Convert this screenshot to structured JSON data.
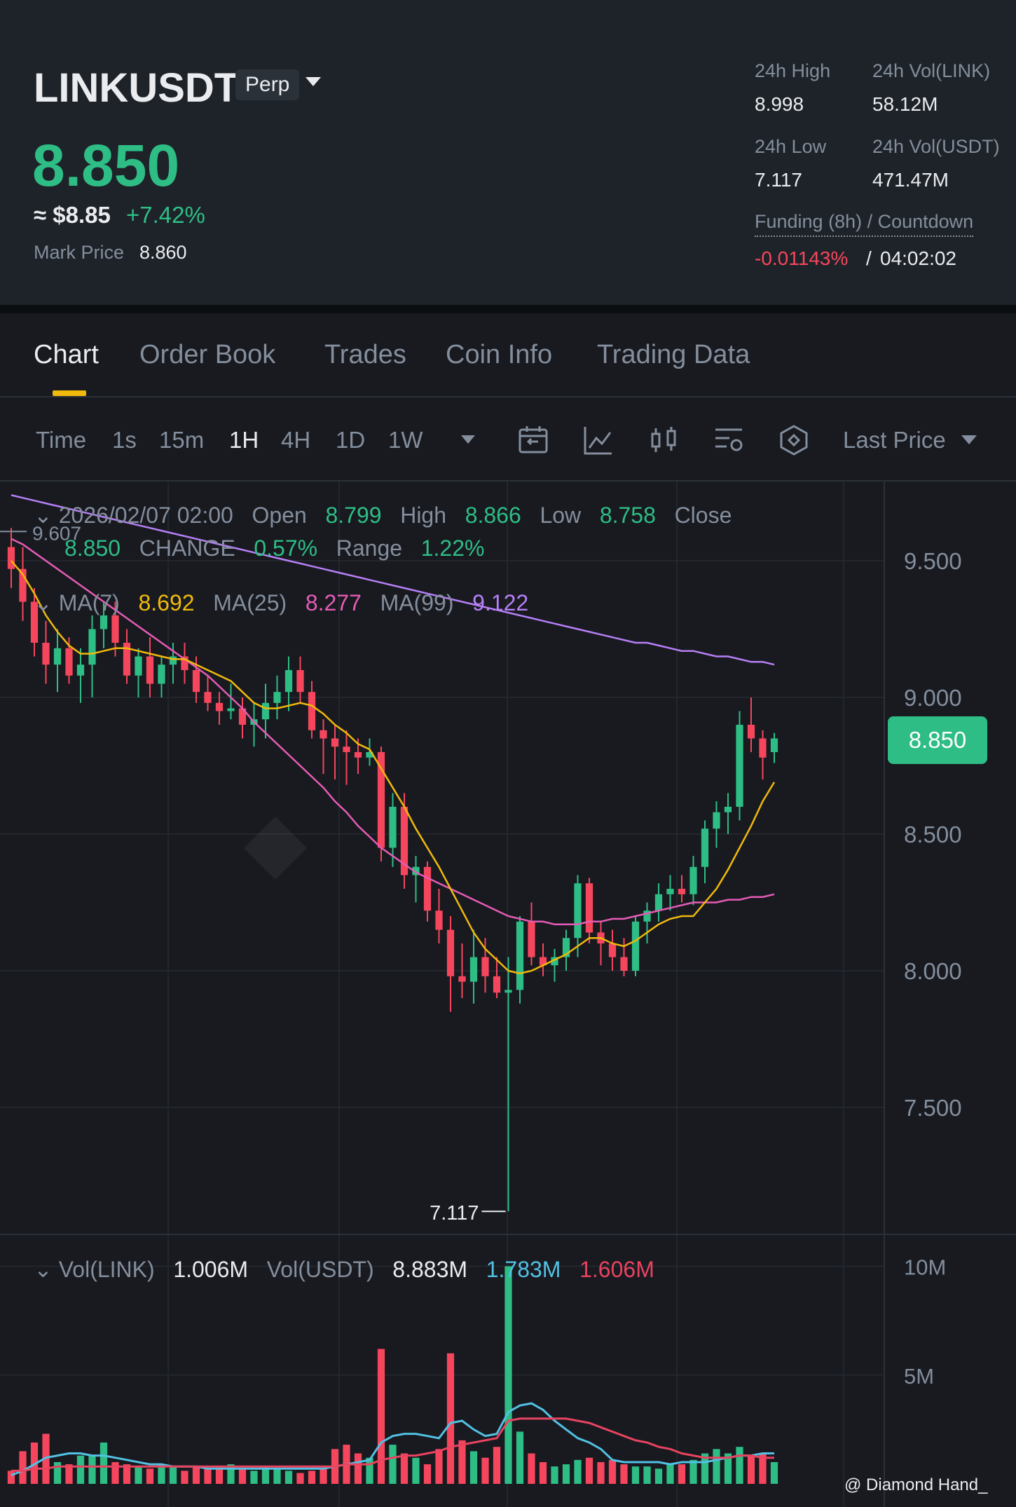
{
  "header": {
    "symbol": "LINKUSDT",
    "contract_type": "Perp",
    "last_price": "8.850",
    "usd_price": "≈ $8.85",
    "change_pct": "+7.42%",
    "mark_price_label": "Mark Price",
    "mark_price": "8.860",
    "stats": {
      "high_label": "24h High",
      "high": "8.998",
      "low_label": "24h Low",
      "low": "7.117",
      "vol_link_label": "24h Vol(LINK)",
      "vol_link": "58.12M",
      "vol_usdt_label": "24h Vol(USDT)",
      "vol_usdt": "471.47M"
    },
    "funding_label": "Funding (8h) / Countdown",
    "funding_rate": "-0.01143%",
    "funding_sep": "/",
    "countdown": "04:02:02"
  },
  "tabs": [
    {
      "label": "Chart",
      "active": true
    },
    {
      "label": "Order Book"
    },
    {
      "label": "Trades"
    },
    {
      "label": "Coin Info"
    },
    {
      "label": "Trading Data"
    }
  ],
  "toolbar": {
    "timeframes": [
      "Time",
      "1s",
      "15m",
      "1H",
      "4H",
      "1D",
      "1W"
    ],
    "active_timeframe": "1H",
    "icons": [
      "calendar-icon",
      "indicator-icon",
      "candle-type-icon",
      "settings-icon",
      "depth-icon"
    ],
    "price_source": "Last Price"
  },
  "chart_info": {
    "date": "2026/02/07 02:00",
    "open_label": "Open",
    "open": "8.799",
    "high_label": "High",
    "high": "8.866",
    "low_label": "Low",
    "low": "8.758",
    "close_label": "Close",
    "close": "8.850",
    "change_label": "CHANGE",
    "change": "0.57%",
    "range_label": "Range",
    "range": "1.22%",
    "ma7_label": "MA(7)",
    "ma7": "8.692",
    "ma25_label": "MA(25)",
    "ma25": "8.277",
    "ma99_label": "MA(99)",
    "ma99": "9.122",
    "left_max_label": "9.607",
    "min_label": "7.117",
    "current_price_tag": "8.850",
    "vol_link_label": "Vol(LINK)",
    "vol_link": "1.006M",
    "vol_usdt_label": "Vol(USDT)",
    "vol_usdt": "8.883M",
    "vol_ma1": "1.783M",
    "vol_ma2": "1.606M",
    "watermark": "@ Diamond Hand_"
  },
  "colors": {
    "up": "#2ebd85",
    "down": "#f6465d",
    "ma7": "#f0b90b",
    "ma25": "#e55bb5",
    "ma99": "#b67ff6",
    "vol_ma1": "#52c1e3",
    "vol_ma2": "#e8435f",
    "accent": "#f0b90b"
  },
  "chart_data": {
    "type": "candlestick",
    "interval": "1H",
    "y_ticks": [
      "9.500",
      "9.000",
      "8.500",
      "8.000",
      "7.500"
    ],
    "y_range": [
      7.0,
      9.75
    ],
    "vol_ticks": [
      "10M",
      "5M"
    ],
    "vol_range": [
      0,
      10.5
    ],
    "candles": [
      [
        9.55,
        9.62,
        9.4,
        9.47
      ],
      [
        9.47,
        9.55,
        9.28,
        9.35
      ],
      [
        9.35,
        9.4,
        9.15,
        9.2
      ],
      [
        9.2,
        9.28,
        9.05,
        9.12
      ],
      [
        9.12,
        9.25,
        9.02,
        9.18
      ],
      [
        9.18,
        9.22,
        9.05,
        9.08
      ],
      [
        9.08,
        9.18,
        8.98,
        9.12
      ],
      [
        9.12,
        9.3,
        9.0,
        9.25
      ],
      [
        9.25,
        9.35,
        9.18,
        9.3
      ],
      [
        9.3,
        9.35,
        9.15,
        9.2
      ],
      [
        9.2,
        9.25,
        9.05,
        9.08
      ],
      [
        9.08,
        9.18,
        9.0,
        9.15
      ],
      [
        9.15,
        9.22,
        9.0,
        9.05
      ],
      [
        9.05,
        9.15,
        9.0,
        9.12
      ],
      [
        9.12,
        9.2,
        9.05,
        9.15
      ],
      [
        9.15,
        9.2,
        9.05,
        9.1
      ],
      [
        9.1,
        9.15,
        8.98,
        9.02
      ],
      [
        9.02,
        9.08,
        8.95,
        8.98
      ],
      [
        8.98,
        9.02,
        8.9,
        8.95
      ],
      [
        8.95,
        9.05,
        8.92,
        8.96
      ],
      [
        8.96,
        9.0,
        8.85,
        8.9
      ],
      [
        8.9,
        8.98,
        8.82,
        8.92
      ],
      [
        8.92,
        9.05,
        8.85,
        8.98
      ],
      [
        8.98,
        9.08,
        8.92,
        9.02
      ],
      [
        9.02,
        9.15,
        8.95,
        9.1
      ],
      [
        9.1,
        9.15,
        8.98,
        9.02
      ],
      [
        9.02,
        9.06,
        8.85,
        8.88
      ],
      [
        8.88,
        8.92,
        8.72,
        8.85
      ],
      [
        8.85,
        8.9,
        8.7,
        8.82
      ],
      [
        8.82,
        8.88,
        8.68,
        8.8
      ],
      [
        8.8,
        8.85,
        8.72,
        8.78
      ],
      [
        8.78,
        8.85,
        8.75,
        8.8
      ],
      [
        8.8,
        8.82,
        8.4,
        8.45
      ],
      [
        8.45,
        8.65,
        8.38,
        8.6
      ],
      [
        8.6,
        8.65,
        8.3,
        8.35
      ],
      [
        8.35,
        8.42,
        8.25,
        8.38
      ],
      [
        8.38,
        8.4,
        8.18,
        8.22
      ],
      [
        8.22,
        8.3,
        8.1,
        8.15
      ],
      [
        8.15,
        8.2,
        7.85,
        7.98
      ],
      [
        7.98,
        8.1,
        7.9,
        7.96
      ],
      [
        7.96,
        8.15,
        7.88,
        8.05
      ],
      [
        8.05,
        8.12,
        7.92,
        7.98
      ],
      [
        7.98,
        8.05,
        7.9,
        7.92
      ],
      [
        7.92,
        8.05,
        7.12,
        7.93
      ],
      [
        7.93,
        8.2,
        7.88,
        8.18
      ],
      [
        8.18,
        8.25,
        8.02,
        8.05
      ],
      [
        8.05,
        8.1,
        7.98,
        8.02
      ],
      [
        8.02,
        8.08,
        7.96,
        8.05
      ],
      [
        8.05,
        8.15,
        8.0,
        8.12
      ],
      [
        8.12,
        8.35,
        8.05,
        8.32
      ],
      [
        8.32,
        8.34,
        8.1,
        8.14
      ],
      [
        8.14,
        8.18,
        8.02,
        8.1
      ],
      [
        8.1,
        8.15,
        8.0,
        8.05
      ],
      [
        8.05,
        8.12,
        7.98,
        8.0
      ],
      [
        8.0,
        8.2,
        7.98,
        8.18
      ],
      [
        8.18,
        8.25,
        8.1,
        8.22
      ],
      [
        8.22,
        8.32,
        8.18,
        8.28
      ],
      [
        8.28,
        8.35,
        8.22,
        8.3
      ],
      [
        8.3,
        8.35,
        8.25,
        8.28
      ],
      [
        8.28,
        8.42,
        8.24,
        8.38
      ],
      [
        8.38,
        8.55,
        8.32,
        8.52
      ],
      [
        8.52,
        8.62,
        8.45,
        8.58
      ],
      [
        8.58,
        8.65,
        8.5,
        8.6
      ],
      [
        8.6,
        8.95,
        8.55,
        8.9
      ],
      [
        8.9,
        9.0,
        8.8,
        8.85
      ],
      [
        8.85,
        8.88,
        8.7,
        8.78
      ],
      [
        8.8,
        8.87,
        8.76,
        8.85
      ]
    ],
    "volumes": [
      0.6,
      1.5,
      1.9,
      2.3,
      1.0,
      0.9,
      1.3,
      1.3,
      1.9,
      1.0,
      0.9,
      0.8,
      0.7,
      0.9,
      0.8,
      0.6,
      0.8,
      0.7,
      0.8,
      0.9,
      0.7,
      0.6,
      0.8,
      0.7,
      0.6,
      0.5,
      0.6,
      0.7,
      1.6,
      1.8,
      1.4,
      1.2,
      6.2,
      1.8,
      1.4,
      1.2,
      0.9,
      1.6,
      6.0,
      2.0,
      1.5,
      1.2,
      1.7,
      10.0,
      2.4,
      1.4,
      1.0,
      0.8,
      0.9,
      1.1,
      1.2,
      1.0,
      1.1,
      0.9,
      0.8,
      0.8,
      0.7,
      0.9,
      0.9,
      1.1,
      1.4,
      1.6,
      1.4,
      1.7,
      1.3,
      1.4,
      1.0
    ],
    "ma7": [
      9.5,
      9.45,
      9.38,
      9.3,
      9.24,
      9.19,
      9.16,
      9.16,
      9.17,
      9.18,
      9.18,
      9.17,
      9.16,
      9.15,
      9.14,
      9.14,
      9.12,
      9.1,
      9.08,
      9.06,
      9.02,
      8.98,
      8.96,
      8.96,
      8.97,
      8.98,
      8.97,
      8.94,
      8.9,
      8.87,
      8.83,
      8.81,
      8.74,
      8.67,
      8.6,
      8.52,
      8.45,
      8.38,
      8.3,
      8.22,
      8.14,
      8.08,
      8.04,
      8.0,
      7.99,
      8.0,
      8.02,
      8.04,
      8.06,
      8.09,
      8.12,
      8.12,
      8.1,
      8.09,
      8.11,
      8.14,
      8.17,
      8.19,
      8.2,
      8.2,
      8.25,
      8.3,
      8.37,
      8.45,
      8.53,
      8.62,
      8.69
    ],
    "ma25": [
      9.58,
      9.56,
      9.53,
      9.5,
      9.47,
      9.44,
      9.41,
      9.38,
      9.35,
      9.32,
      9.29,
      9.26,
      9.23,
      9.2,
      9.17,
      9.14,
      9.11,
      9.08,
      9.04,
      9.0,
      8.96,
      8.91,
      8.87,
      8.83,
      8.79,
      8.75,
      8.71,
      8.67,
      8.62,
      8.58,
      8.53,
      8.49,
      8.45,
      8.42,
      8.39,
      8.36,
      8.34,
      8.32,
      8.3,
      8.28,
      8.26,
      8.24,
      8.22,
      8.2,
      8.19,
      8.18,
      8.18,
      8.17,
      8.17,
      8.17,
      8.18,
      8.18,
      8.19,
      8.19,
      8.2,
      8.21,
      8.22,
      8.23,
      8.24,
      8.25,
      8.25,
      8.25,
      8.26,
      8.26,
      8.27,
      8.27,
      8.28
    ],
    "ma99": [
      9.74,
      9.73,
      9.72,
      9.71,
      9.7,
      9.69,
      9.68,
      9.67,
      9.66,
      9.65,
      9.64,
      9.63,
      9.62,
      9.61,
      9.6,
      9.59,
      9.58,
      9.57,
      9.56,
      9.55,
      9.54,
      9.53,
      9.52,
      9.51,
      9.5,
      9.49,
      9.48,
      9.47,
      9.46,
      9.45,
      9.44,
      9.43,
      9.42,
      9.41,
      9.4,
      9.39,
      9.38,
      9.37,
      9.36,
      9.35,
      9.34,
      9.33,
      9.32,
      9.31,
      9.3,
      9.29,
      9.28,
      9.27,
      9.26,
      9.25,
      9.24,
      9.23,
      9.22,
      9.21,
      9.2,
      9.2,
      9.19,
      9.18,
      9.17,
      9.17,
      9.16,
      9.15,
      9.15,
      9.14,
      9.13,
      9.13,
      9.12
    ],
    "vol_ma1": [
      0.4,
      0.6,
      0.9,
      1.2,
      1.3,
      1.4,
      1.4,
      1.3,
      1.3,
      1.2,
      1.1,
      1.0,
      0.9,
      0.9,
      0.8,
      0.8,
      0.8,
      0.7,
      0.7,
      0.7,
      0.7,
      0.7,
      0.7,
      0.7,
      0.7,
      0.7,
      0.7,
      0.7,
      0.8,
      0.9,
      1.0,
      1.1,
      1.9,
      2.2,
      2.3,
      2.3,
      2.2,
      2.1,
      2.8,
      2.9,
      2.5,
      2.2,
      2.3,
      3.3,
      3.6,
      3.7,
      3.4,
      2.9,
      2.5,
      2.1,
      1.9,
      1.6,
      1.1,
      1.0,
      1.0,
      1.0,
      1.0,
      0.9,
      1.0,
      1.0,
      1.0,
      1.1,
      1.2,
      1.3,
      1.3,
      1.4,
      1.4
    ],
    "vol_ma2": [
      0.6,
      0.6,
      0.7,
      0.7,
      0.8,
      0.8,
      0.8,
      0.8,
      0.8,
      0.8,
      0.8,
      0.8,
      0.8,
      0.8,
      0.8,
      0.8,
      0.8,
      0.8,
      0.8,
      0.8,
      0.8,
      0.8,
      0.8,
      0.8,
      0.8,
      0.8,
      0.8,
      0.8,
      0.8,
      0.9,
      0.9,
      0.9,
      1.1,
      1.2,
      1.3,
      1.3,
      1.4,
      1.5,
      1.7,
      1.8,
      1.9,
      2.0,
      2.1,
      2.9,
      3.0,
      3.0,
      3.0,
      3.0,
      3.0,
      2.9,
      2.8,
      2.6,
      2.4,
      2.2,
      2.0,
      1.9,
      1.7,
      1.6,
      1.4,
      1.3,
      1.2,
      1.2,
      1.2,
      1.3,
      1.3,
      1.2,
      1.2
    ]
  }
}
